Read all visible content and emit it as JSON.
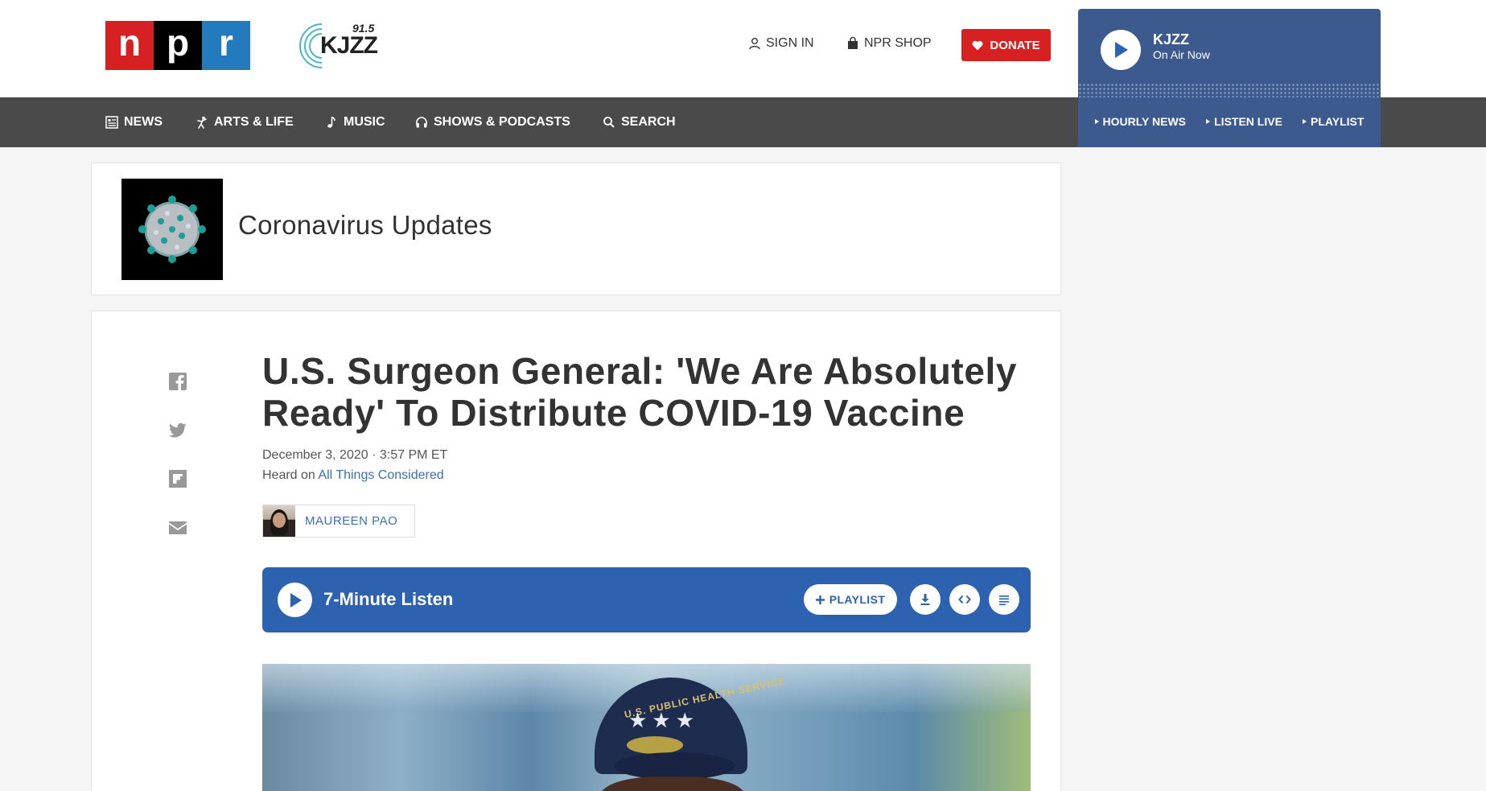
{
  "header": {
    "npr_letters": [
      "n",
      "p",
      "r"
    ],
    "station_logo": {
      "frequency": "91.5",
      "name": "KJZZ"
    },
    "sign_in": "SIGN IN",
    "shop": "NPR SHOP",
    "donate": "DONATE"
  },
  "nav": {
    "items": [
      {
        "label": "NEWS",
        "icon": "newspaper-icon"
      },
      {
        "label": "ARTS & LIFE",
        "icon": "dancer-icon"
      },
      {
        "label": "MUSIC",
        "icon": "music-note-icon"
      },
      {
        "label": "SHOWS & PODCASTS",
        "icon": "headphones-icon"
      },
      {
        "label": "SEARCH",
        "icon": "search-icon"
      }
    ]
  },
  "player": {
    "station": "KJZZ",
    "status": "On Air Now",
    "links": [
      "HOURLY NEWS",
      "LISTEN LIVE",
      "PLAYLIST"
    ]
  },
  "series": {
    "title": "Coronavirus Updates"
  },
  "article": {
    "headline": "U.S. Surgeon General: 'We Are Absolutely Ready' To Distribute COVID-19 Vaccine",
    "dateline": "December 3, 2020 · 3:57 PM ET",
    "heard_on_prefix": "Heard on ",
    "heard_on_show": "All Things Considered",
    "author": "MAUREEN PAO",
    "share_icons": [
      "facebook-icon",
      "twitter-icon",
      "flipboard-icon",
      "email-icon"
    ]
  },
  "audio": {
    "title": "7-Minute Listen",
    "playlist_label": "PLAYLIST"
  },
  "hero": {
    "cap_text": "U.S. PUBLIC HEALTH SERVICE",
    "stars": "★★★"
  },
  "colors": {
    "npr_red": "#d62021",
    "npr_blue": "#237bbd",
    "audio_blue": "#2c62b0",
    "player_blue": "#3d5a8f",
    "nav_gray": "#4a4a4a",
    "link_blue": "#3b6fb4"
  }
}
